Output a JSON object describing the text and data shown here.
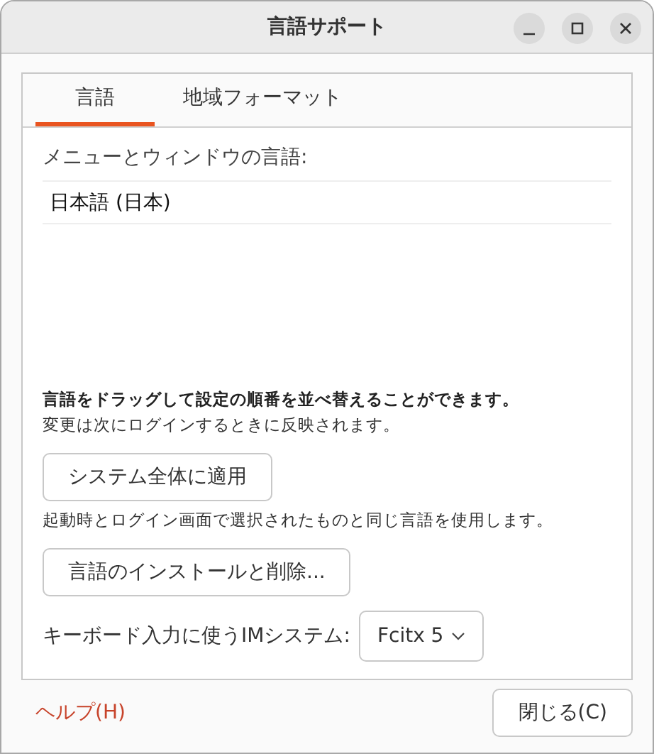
{
  "window": {
    "title": "言語サポート"
  },
  "tabs": [
    {
      "label": "言語",
      "selected": true
    },
    {
      "label": "地域フォーマット",
      "selected": false
    }
  ],
  "language_list": {
    "label": "メニューとウィンドウの言語:",
    "items": [
      "日本語 (日本)"
    ]
  },
  "hint_bold": "言語をドラッグして設定の順番を並べ替えることができます。",
  "hint": "変更は次にログインするときに反映されます。",
  "apply_button": "システム全体に適用",
  "apply_hint": "起動時とログイン画面で選択されたものと同じ言語を使用します。",
  "install_button": "言語のインストールと削除...",
  "im_system": {
    "label": "キーボード入力に使うIMシステム:",
    "value": "Fcitx 5"
  },
  "footer": {
    "help": "ヘルプ(H)",
    "close": "閉じる(C)"
  }
}
